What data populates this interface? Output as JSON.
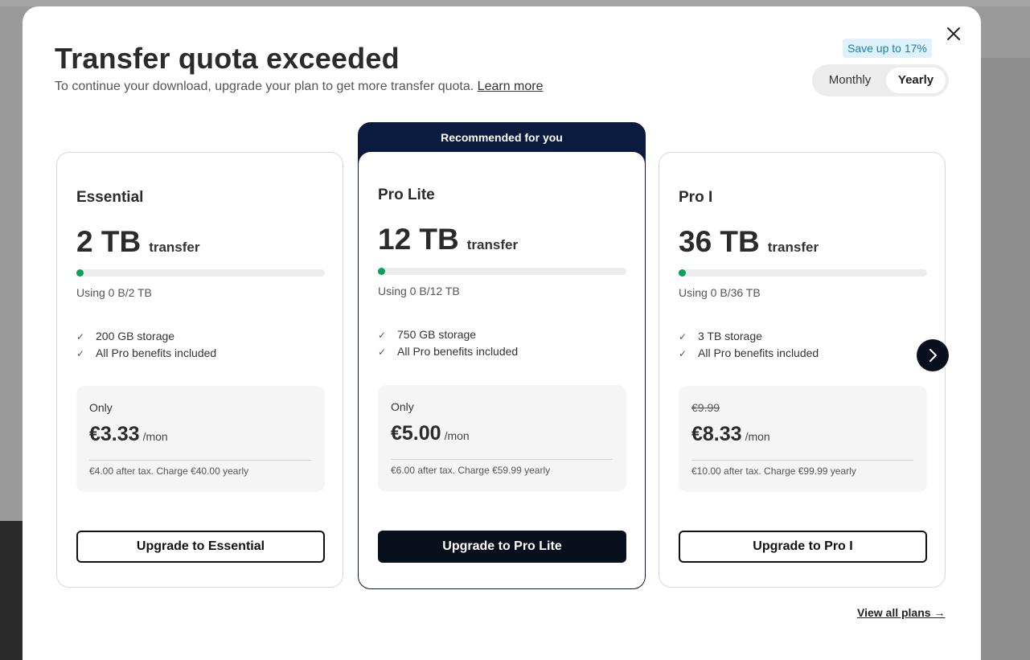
{
  "modal": {
    "title": "Transfer quota exceeded",
    "subtitle": "To continue your download, upgrade your plan to get more transfer quota.",
    "learn_more": "Learn more",
    "save_badge": "Save up to 17%",
    "billing_toggle": {
      "monthly": "Monthly",
      "yearly": "Yearly",
      "selected": "Yearly"
    },
    "recommended_label": "Recommended for you",
    "view_all": "View all plans →"
  },
  "plans": [
    {
      "name": "Essential",
      "amount": "2 TB",
      "unit": "transfer",
      "usage_fraction": 0,
      "usage": "Using 0 B/2 TB",
      "features": [
        "200 GB storage",
        "All Pro benefits included"
      ],
      "price_top": "Only",
      "price": "€3.33",
      "per": "/mon",
      "note": "€4.00 after tax. Charge €40.00 yearly",
      "button": "Upgrade to Essential"
    },
    {
      "name": "Pro Lite",
      "amount": "12 TB",
      "unit": "transfer",
      "usage_fraction": 0,
      "usage": "Using 0 B/12 TB",
      "features": [
        "750 GB storage",
        "All Pro benefits included"
      ],
      "price_top": "Only",
      "price": "€5.00",
      "per": "/mon",
      "note": "€6.00 after tax. Charge €59.99 yearly",
      "button": "Upgrade to Pro Lite"
    },
    {
      "name": "Pro I",
      "amount": "36 TB",
      "unit": "transfer",
      "usage_fraction": 0,
      "usage": "Using 0 B/36 TB",
      "features": [
        "3 TB storage",
        "All Pro benefits included"
      ],
      "price_top": "€9.99",
      "price": "€8.33",
      "per": "/mon",
      "note": "€10.00 after tax. Charge €99.99 yearly",
      "button": "Upgrade to Pro I"
    }
  ],
  "icons": {
    "close": "close-icon",
    "check": "check-icon",
    "next": "chevron-right-icon"
  },
  "colors": {
    "usage_green": "#0aa05c",
    "recommended_bg": "#0b1a3f",
    "save_badge_bg": "#dff2fb"
  }
}
